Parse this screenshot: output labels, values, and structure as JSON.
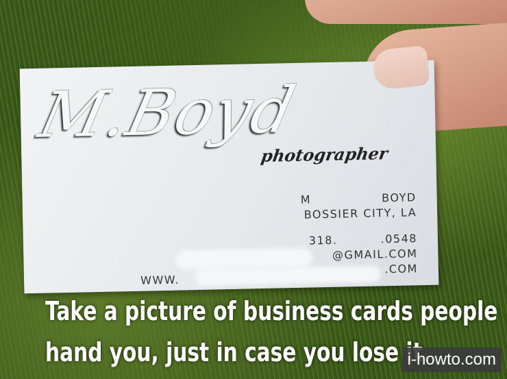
{
  "card": {
    "logo": "M.Boyd",
    "tagline": "photographer",
    "name_first": "M",
    "name_last": "Boyd",
    "location": "Bossier City, LA",
    "phone_prefix": "318.",
    "phone_suffix": ".0548",
    "email": "@gmail.com",
    "web_prefix": "www.",
    "web_suffix": ".com"
  },
  "caption": {
    "line1": "Take a picture of business cards people",
    "line2": "hand you, just in case you lose it."
  },
  "watermark": "i-howto.com"
}
